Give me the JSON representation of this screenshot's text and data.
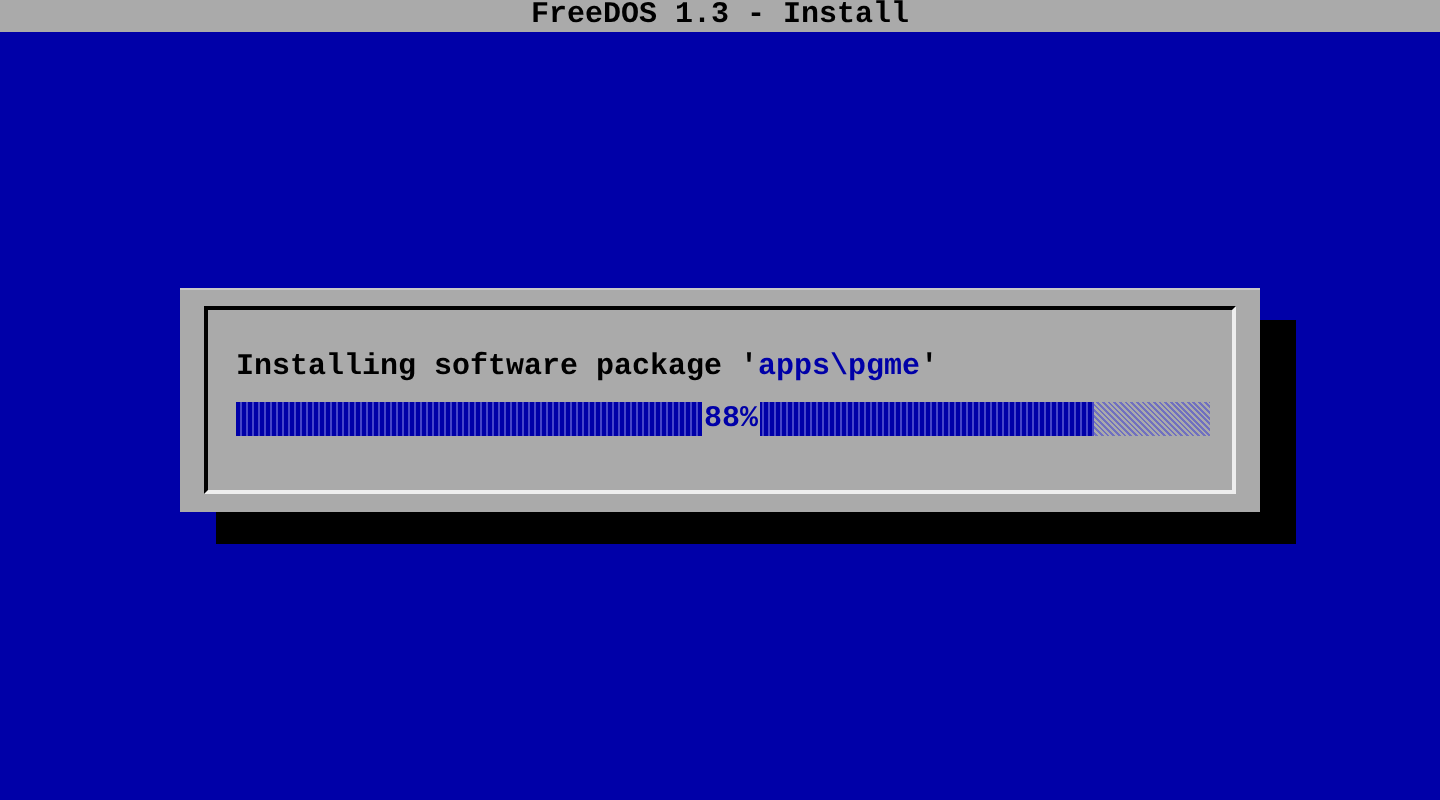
{
  "title_bar": {
    "title": "FreeDOS 1.3 - Install"
  },
  "dialog": {
    "message": [
      {
        "kind": "plain",
        "text": "Installing software package '"
      },
      {
        "kind": "highlight",
        "text": "apps\\pgme"
      },
      {
        "kind": "plain",
        "text": "'"
      }
    ],
    "progress": {
      "level": 0.88,
      "reading": "88%"
    }
  }
}
